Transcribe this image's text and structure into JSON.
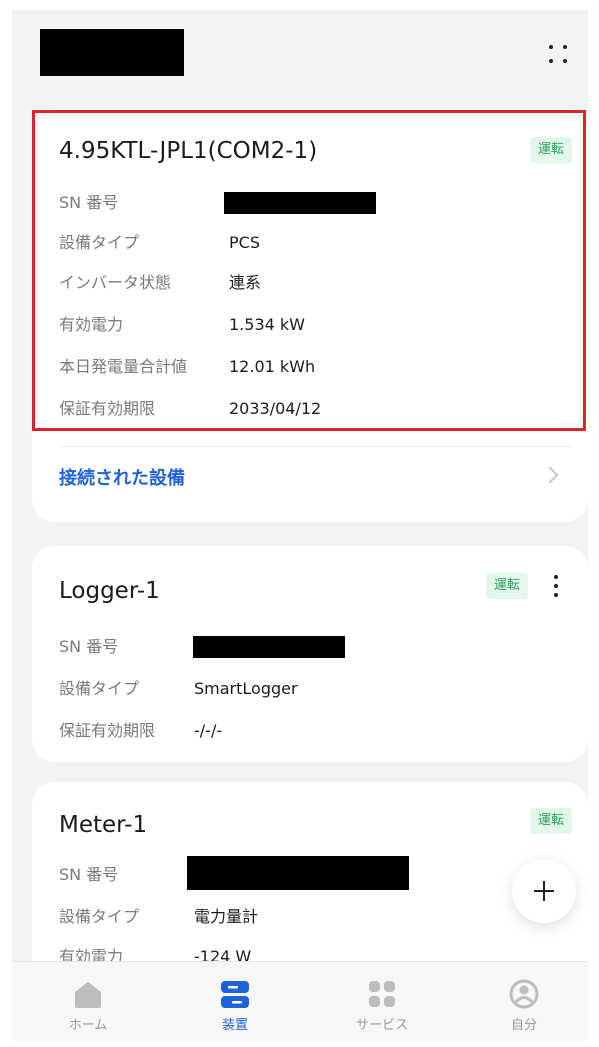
{
  "header": {
    "more_icon": "grid-dots-icon"
  },
  "devices": [
    {
      "name": "4.95KTL-JPL1(COM2-1)",
      "status": "運転",
      "rows": [
        {
          "label": "SN 番号",
          "value": ""
        },
        {
          "label": "設備タイプ",
          "value": "PCS"
        },
        {
          "label": "インバータ状態",
          "value": "連系"
        },
        {
          "label": "有効電力",
          "value": "1.534 kW"
        },
        {
          "label": "本日発電量合計値",
          "value": "12.01 kWh"
        },
        {
          "label": "保証有効期限",
          "value": "2033/04/12"
        }
      ],
      "link_label": "接続された設備"
    },
    {
      "name": "Logger-1",
      "status": "運転",
      "rows": [
        {
          "label": "SN 番号",
          "value": ""
        },
        {
          "label": "設備タイプ",
          "value": "SmartLogger"
        },
        {
          "label": "保証有効期限",
          "value": "-/-/-"
        }
      ]
    },
    {
      "name": "Meter-1",
      "status": "運転",
      "rows": [
        {
          "label": "SN 番号",
          "value": ""
        },
        {
          "label": "設備タイプ",
          "value": "電力量計"
        },
        {
          "label": "有効電力",
          "value": "-124 W"
        }
      ]
    }
  ],
  "tabs": [
    {
      "label": "ホーム",
      "icon": "home-icon",
      "active": false
    },
    {
      "label": "装置",
      "icon": "devices-icon",
      "active": true
    },
    {
      "label": "サービス",
      "icon": "services-icon",
      "active": false
    },
    {
      "label": "自分",
      "icon": "profile-icon",
      "active": false
    }
  ],
  "colors": {
    "accent": "#1f63d8",
    "status_bg": "#e3f6ea",
    "status_text": "#2aa05a",
    "highlight": "#d8252b"
  }
}
